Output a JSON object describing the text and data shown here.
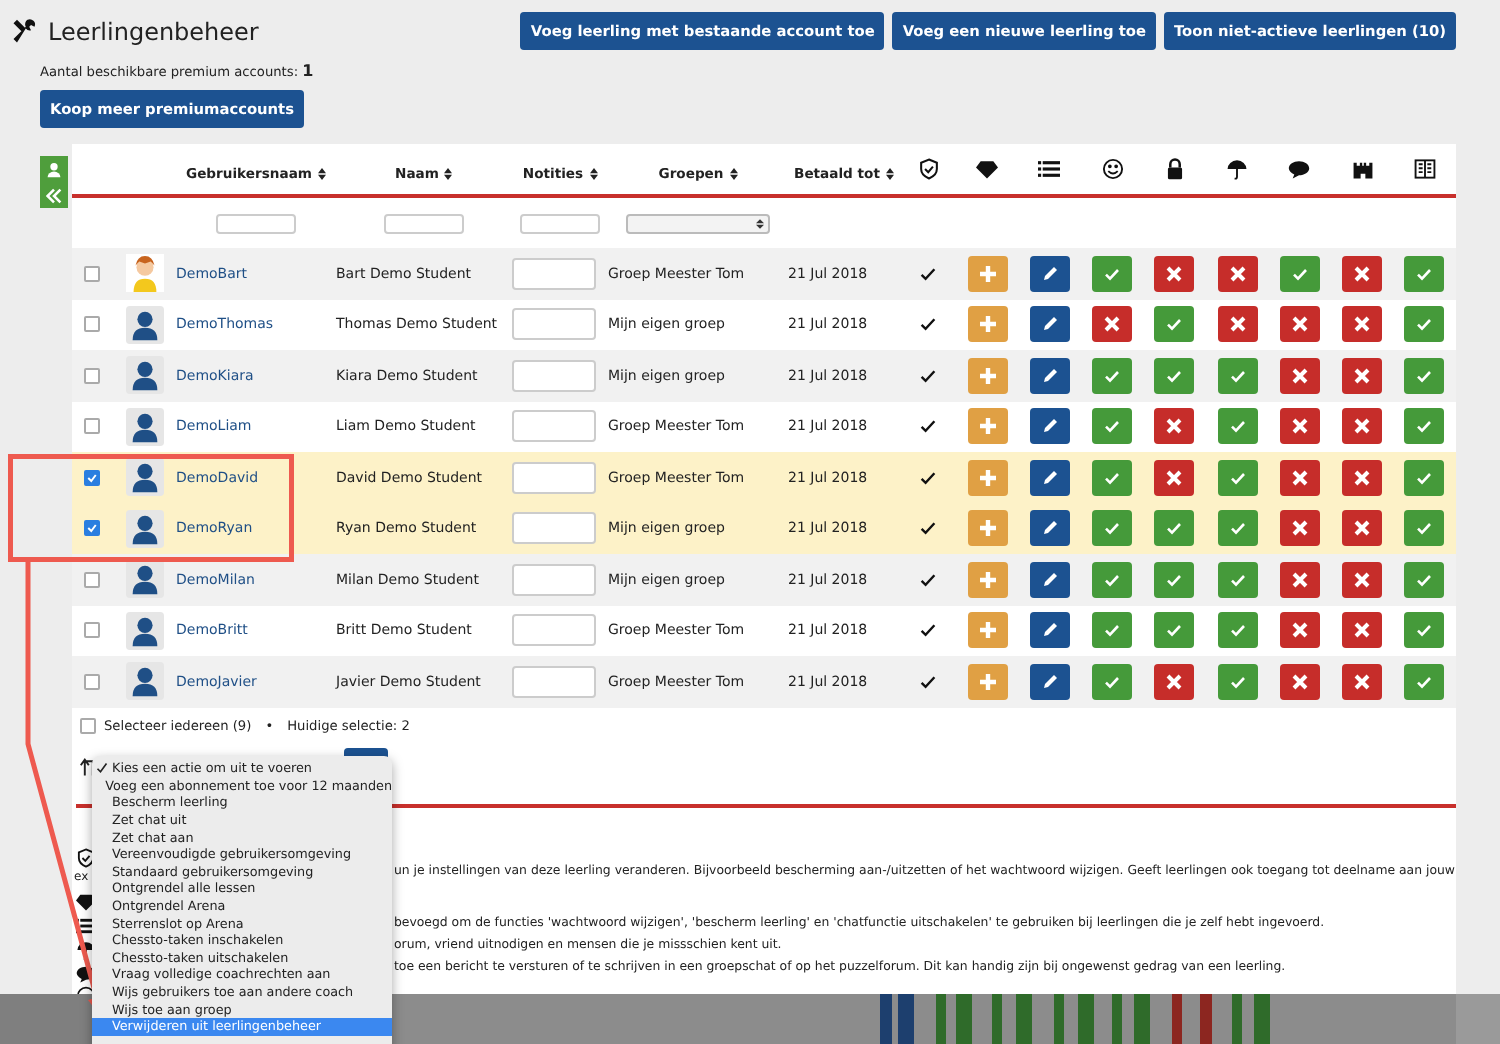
{
  "header": {
    "title": "Leerlingenbeheer",
    "buttons": [
      "Voeg leerling met bestaande account toe",
      "Voeg een nieuwe leerling toe",
      "Toon niet-actieve leerlingen (10)"
    ],
    "premium_label": "Aantal beschikbare premium accounts:",
    "premium_count": "1",
    "buy_button": "Koop meer premiumaccounts"
  },
  "table": {
    "columns": [
      "Gebruikersnaam",
      "Naam",
      "Notities",
      "Groepen",
      "Betaald tot"
    ],
    "rows": [
      {
        "selected": false,
        "avatar": {
          "kind": "cartoon"
        },
        "username": "DemoBart",
        "name": "Bart Demo Student",
        "group": "Groep Meester Tom",
        "paid_until": "21 Jul 2018",
        "protected": true,
        "permissions": [
          true,
          false,
          false,
          true,
          false,
          true
        ]
      },
      {
        "selected": false,
        "avatar": {
          "kind": "silhouette"
        },
        "username": "DemoThomas",
        "name": "Thomas Demo Student",
        "group": "Mijn eigen groep",
        "paid_until": "21 Jul 2018",
        "protected": true,
        "permissions": [
          false,
          true,
          false,
          false,
          false,
          true
        ]
      },
      {
        "selected": false,
        "avatar": {
          "kind": "silhouette"
        },
        "username": "DemoKiara",
        "name": "Kiara Demo Student",
        "group": "Mijn eigen groep",
        "paid_until": "21 Jul 2018",
        "protected": true,
        "permissions": [
          true,
          true,
          true,
          false,
          false,
          true
        ]
      },
      {
        "selected": false,
        "avatar": {
          "kind": "silhouette"
        },
        "username": "DemoLiam",
        "name": "Liam Demo Student",
        "group": "Groep Meester Tom",
        "paid_until": "21 Jul 2018",
        "protected": true,
        "permissions": [
          true,
          false,
          true,
          false,
          false,
          true
        ]
      },
      {
        "selected": true,
        "avatar": {
          "kind": "silhouette"
        },
        "username": "DemoDavid",
        "name": "David Demo Student",
        "group": "Groep Meester Tom",
        "paid_until": "21 Jul 2018",
        "protected": true,
        "permissions": [
          true,
          false,
          true,
          false,
          false,
          true
        ]
      },
      {
        "selected": true,
        "avatar": {
          "kind": "silhouette"
        },
        "username": "DemoRyan",
        "name": "Ryan Demo Student",
        "group": "Mijn eigen groep",
        "paid_until": "21 Jul 2018",
        "protected": true,
        "permissions": [
          true,
          true,
          true,
          false,
          false,
          true
        ]
      },
      {
        "selected": false,
        "avatar": {
          "kind": "silhouette"
        },
        "username": "DemoMilan",
        "name": "Milan Demo Student",
        "group": "Mijn eigen groep",
        "paid_until": "21 Jul 2018",
        "protected": true,
        "permissions": [
          true,
          true,
          true,
          false,
          false,
          true
        ]
      },
      {
        "selected": false,
        "avatar": {
          "kind": "silhouette"
        },
        "username": "DemoBritt",
        "name": "Britt Demo Student",
        "group": "Groep Meester Tom",
        "paid_until": "21 Jul 2018",
        "protected": true,
        "permissions": [
          true,
          true,
          true,
          false,
          false,
          true
        ]
      },
      {
        "selected": false,
        "avatar": {
          "kind": "silhouette"
        },
        "username": "DemoJavier",
        "name": "Javier Demo Student",
        "group": "Groep Meester Tom",
        "paid_until": "21 Jul 2018",
        "protected": true,
        "permissions": [
          true,
          false,
          true,
          false,
          false,
          true
        ]
      }
    ],
    "select_all": {
      "label": "Selecteer iedereen (9)",
      "checked": false
    },
    "bullet": "•",
    "current_selection": "Huidige selectie: 2"
  },
  "action_menu": {
    "items": [
      {
        "label": "Kies een actie om uit te voeren",
        "checked": true,
        "selected": false
      },
      {
        "label": "Voeg een abonnement toe voor 12 maanden",
        "checked": false,
        "selected": false
      },
      {
        "label": "Bescherm leerling",
        "checked": false,
        "selected": false
      },
      {
        "label": "Zet chat uit",
        "checked": false,
        "selected": false
      },
      {
        "label": "Zet chat aan",
        "checked": false,
        "selected": false
      },
      {
        "label": "Vereenvoudigde gebruikersomgeving",
        "checked": false,
        "selected": false
      },
      {
        "label": "Standaard gebruikersomgeving",
        "checked": false,
        "selected": false
      },
      {
        "label": "Ontgrendel alle lessen",
        "checked": false,
        "selected": false
      },
      {
        "label": "Ontgrendel Arena",
        "checked": false,
        "selected": false
      },
      {
        "label": "Sterrenslot op Arena",
        "checked": false,
        "selected": false
      },
      {
        "label": "Chessto-taken inschakelen",
        "checked": false,
        "selected": false
      },
      {
        "label": "Chessto-taken uitschakelen",
        "checked": false,
        "selected": false
      },
      {
        "label": "Vraag volledige coachrechten aan",
        "checked": false,
        "selected": false
      },
      {
        "label": "Wijs gebruikers toe aan andere coach",
        "checked": false,
        "selected": false
      },
      {
        "label": "Wijs toe aan groep",
        "checked": false,
        "selected": false
      },
      {
        "label": "Verwijderen uit leerlingenbeheer",
        "checked": false,
        "selected": true
      }
    ]
  },
  "legend": {
    "shield_caption": "ex",
    "lines": [
      "un je instellingen van deze leerling veranderen. Bijvoorbeeld bescherming aan-/uitzetten of het wachtwoord wijzigen. Geeft leerlingen ook toegang tot deelname aan jouw",
      "bevoegd om de functies 'wachtwoord wijzigen', 'bescherm leerling' en 'chatfunctie uitschakelen' te gebruiken bij leerlingen die je zelf hebt ingevoerd.",
      "orum, vriend uitnodigen en mensen die je missschien kent uit.",
      "toe een bericht te versturen of te schrijven in een groepschat of op het puzzelforum. Dit kan handig zijn bij ongewenst gedrag van een leerling."
    ]
  }
}
